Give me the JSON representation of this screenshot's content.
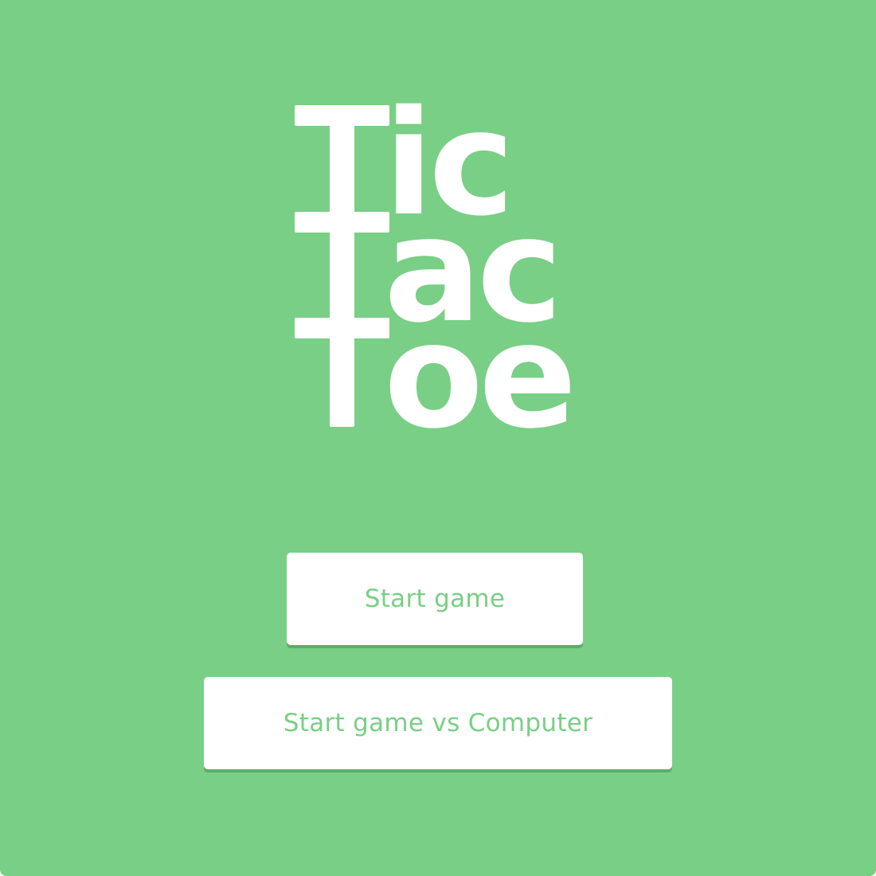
{
  "app": {
    "logo_lines": [
      "Tic",
      "Tac",
      "Toe"
    ],
    "accent_color": "#79cf85",
    "text_color": "#ffffff"
  },
  "menu": {
    "start_game_label": "Start game",
    "start_vs_computer_label": "Start game vs Computer"
  }
}
